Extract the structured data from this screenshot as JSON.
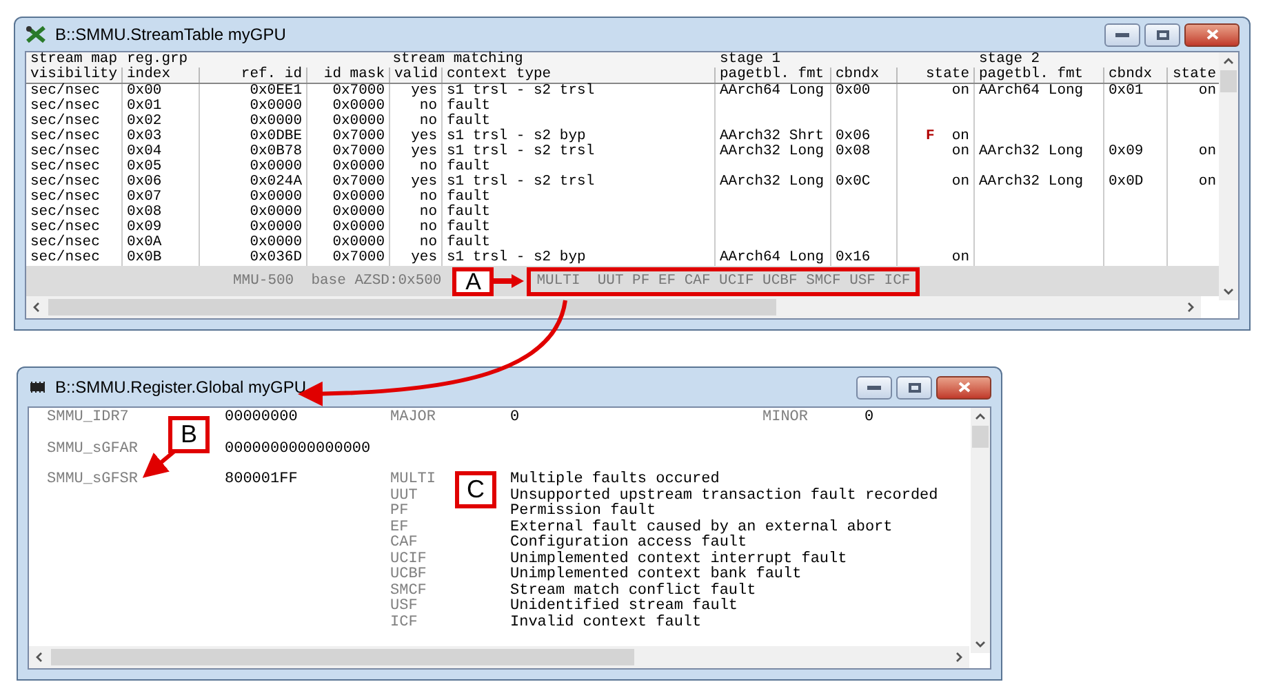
{
  "stream_window": {
    "title": "B::SMMU.StreamTable myGPU",
    "columns": [
      {
        "group": "stream map",
        "label": "visibility"
      },
      {
        "group": "reg.grp",
        "label": "index"
      },
      {
        "group": "stream matching",
        "label": "ref. id"
      },
      {
        "label": "id mask"
      },
      {
        "label": "valid"
      },
      {
        "label": "context type"
      },
      {
        "group": "stage 1",
        "label": "pagetbl. fmt"
      },
      {
        "label": "cbndx"
      },
      {
        "label": "state"
      },
      {
        "group": "stage 2",
        "label": "pagetbl. fmt"
      },
      {
        "label": "cbndx"
      },
      {
        "label": "state"
      }
    ],
    "rows": [
      [
        "sec/nsec",
        "0x00",
        "0x0EE1",
        "0x7000",
        "yes",
        "s1 trsl - s2 trsl",
        "AArch64 Long",
        "0x00",
        "on",
        "AArch64 Long",
        "0x01",
        "on"
      ],
      [
        "sec/nsec",
        "0x01",
        "0x0000",
        "0x0000",
        "no",
        "fault"
      ],
      [
        "sec/nsec",
        "0x02",
        "0x0000",
        "0x0000",
        "no",
        "fault"
      ],
      [
        "sec/nsec",
        "0x03",
        "0x0DBE",
        "0x7000",
        "yes",
        "s1 trsl - s2 byp",
        "AArch32 Shrt",
        "0x06",
        "**F**  on"
      ],
      [
        "sec/nsec",
        "0x04",
        "0x0B78",
        "0x7000",
        "yes",
        "s1 trsl - s2 trsl",
        "AArch32 Long",
        "0x08",
        "on",
        "AArch32 Long",
        "0x09",
        "on"
      ],
      [
        "sec/nsec",
        "0x05",
        "0x0000",
        "0x0000",
        "no",
        "fault"
      ],
      [
        "sec/nsec",
        "0x06",
        "0x024A",
        "0x7000",
        "yes",
        "s1 trsl - s2 trsl",
        "AArch32 Long",
        "0x0C",
        "on",
        "AArch32 Long",
        "0x0D",
        "on"
      ],
      [
        "sec/nsec",
        "0x07",
        "0x0000",
        "0x0000",
        "no",
        "fault"
      ],
      [
        "sec/nsec",
        "0x08",
        "0x0000",
        "0x0000",
        "no",
        "fault"
      ],
      [
        "sec/nsec",
        "0x09",
        "0x0000",
        "0x0000",
        "no",
        "fault"
      ],
      [
        "sec/nsec",
        "0x0A",
        "0x0000",
        "0x0000",
        "no",
        "fault"
      ],
      [
        "sec/nsec",
        "0x0B",
        "0x036D",
        "0x7000",
        "yes",
        "s1 trsl - s2 byp",
        "AArch64 Long",
        "0x16",
        "on"
      ]
    ],
    "status_bar": {
      "device": "MMU-500  base AZSD:0x500",
      "flags": "MULTI  UUT PF EF CAF UCIF UCBF SMCF USF ICF"
    }
  },
  "register_window": {
    "title": "B::SMMU.Register.Global myGPU",
    "registers": [
      {
        "kind": "pairs",
        "name": "SMMU_IDR7",
        "value": "00000000",
        "fields": [
          {
            "name": "MAJOR",
            "value": "0"
          },
          {
            "name": "MINOR",
            "value": "0"
          }
        ]
      },
      {
        "kind": "pairs",
        "name": "SMMU_sGFAR",
        "value": "0000000000000000"
      },
      {
        "kind": "bits",
        "name": "SMMU_sGFSR",
        "value": "800001FF",
        "fields": [
          {
            "name": "MULTI",
            "value": "Multiple faults occured"
          },
          {
            "name": "UUT",
            "value": "Unsupported upstream transaction fault recorded"
          },
          {
            "name": "PF",
            "value": "Permission fault"
          },
          {
            "name": "EF",
            "value": "External fault caused by an external abort"
          },
          {
            "name": "CAF",
            "value": "Configuration access fault"
          },
          {
            "name": "UCIF",
            "value": "Unimplemented context interrupt fault"
          },
          {
            "name": "UCBF",
            "value": "Unimplemented context bank fault"
          },
          {
            "name": "SMCF",
            "value": "Stream match conflict fault"
          },
          {
            "name": "USF",
            "value": "Unidentified stream fault"
          },
          {
            "name": "ICF",
            "value": "Invalid context fault"
          }
        ]
      }
    ]
  },
  "annotations": [
    {
      "label": "A"
    },
    {
      "label": "B"
    },
    {
      "label": "C"
    }
  ]
}
